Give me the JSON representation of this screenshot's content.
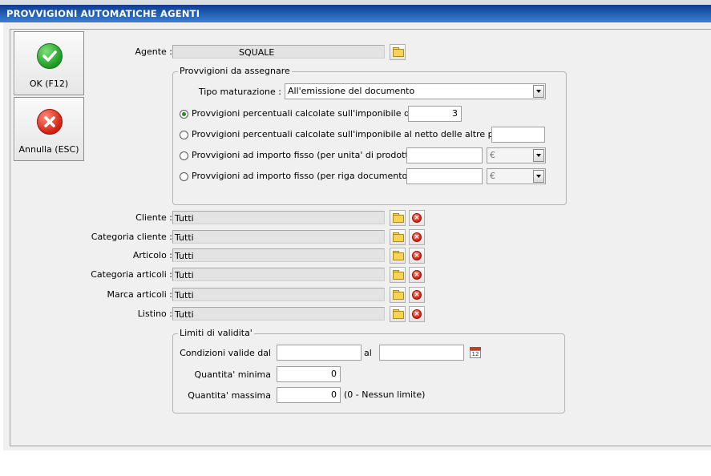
{
  "window": {
    "title": "PROVVIGIONI AUTOMATICHE AGENTI"
  },
  "buttons": {
    "ok_label": "OK (F12)",
    "cancel_label": "Annulla (ESC)"
  },
  "agent": {
    "label": "Agente :",
    "value": "SQUALE"
  },
  "commission_group": {
    "title": "Provvigioni da assegnare",
    "tipo_label": "Tipo maturazione :",
    "tipo_value": "All'emissione del documento",
    "options": [
      {
        "label": "Provvigioni percentuali calcolate sull'imponibile di riga",
        "value": "3",
        "selected": true
      },
      {
        "label": "Provvigioni percentuali calcolate sull'imponibile al netto delle altre provvigioni",
        "value": "",
        "selected": false
      },
      {
        "label": "Provvigioni ad importo fisso (per unita' di prodotto)",
        "value": "",
        "currency": "€",
        "selected": false
      },
      {
        "label": "Provvigioni ad importo fisso (per riga documento)",
        "value": "",
        "currency": "€",
        "selected": false
      }
    ]
  },
  "filters": [
    {
      "label": "Cliente :",
      "value": "Tutti"
    },
    {
      "label": "Categoria cliente :",
      "value": "Tutti"
    },
    {
      "label": "Articolo :",
      "value": "Tutti"
    },
    {
      "label": "Categoria articoli :",
      "value": "Tutti"
    },
    {
      "label": "Marca articoli :",
      "value": "Tutti"
    },
    {
      "label": "Listino :",
      "value": "Tutti"
    }
  ],
  "validity": {
    "title": "Limiti di validita'",
    "from_label": "Condizioni valide dal",
    "from_value": "",
    "to_label": "al",
    "to_value": "",
    "min_label": "Quantita' minima",
    "min_value": "0",
    "max_label": "Quantita' massima",
    "max_value": "0",
    "max_note": "(0 - Nessun limite)",
    "calendar_day": "12"
  },
  "colors": {
    "titlebar": "#0a3d8f",
    "ok": "#1e9a22",
    "cancel": "#d21f10"
  }
}
